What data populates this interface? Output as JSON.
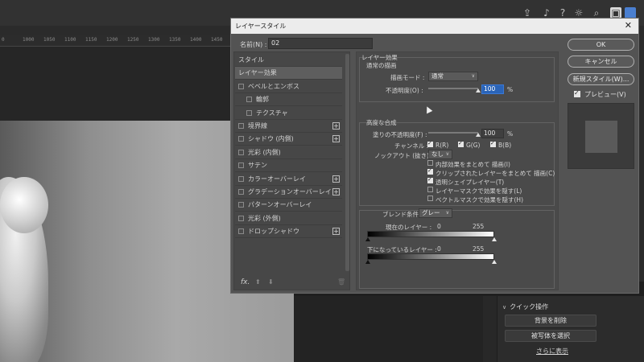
{
  "background": {
    "ruler_ticks": [
      "0",
      "1000",
      "1050",
      "1100",
      "1150",
      "1200",
      "1250",
      "1300",
      "1350",
      "1400",
      "1450"
    ],
    "quick_actions": {
      "header": "クイック操作",
      "remove_bg": "背景を削除",
      "select_subject": "被写体を選択",
      "more": "さらに表示"
    }
  },
  "dialog": {
    "title": "レイヤースタイル",
    "close_icon": "close-icon",
    "name_label": "名前(N) :",
    "name_value": "02",
    "style_list": [
      {
        "label": "スタイル",
        "checkbox": false,
        "plus": false,
        "indent": 0,
        "active": false
      },
      {
        "label": "レイヤー効果",
        "checkbox": false,
        "plus": false,
        "indent": 0,
        "active": true
      },
      {
        "label": "ベベルとエンボス",
        "checkbox": true,
        "plus": false,
        "indent": 0,
        "active": false
      },
      {
        "label": "輪郭",
        "checkbox": true,
        "plus": false,
        "indent": 1,
        "active": false
      },
      {
        "label": "テクスチャ",
        "checkbox": true,
        "plus": false,
        "indent": 1,
        "active": false
      },
      {
        "label": "境界線",
        "checkbox": true,
        "plus": true,
        "indent": 0,
        "active": false
      },
      {
        "label": "シャドウ (内側)",
        "checkbox": true,
        "plus": true,
        "indent": 0,
        "active": false
      },
      {
        "label": "光彩 (内側)",
        "checkbox": true,
        "plus": false,
        "indent": 0,
        "active": false
      },
      {
        "label": "サテン",
        "checkbox": true,
        "plus": false,
        "indent": 0,
        "active": false
      },
      {
        "label": "カラーオーバーレイ",
        "checkbox": true,
        "plus": true,
        "indent": 0,
        "active": false
      },
      {
        "label": "グラデーションオーバーレイ",
        "checkbox": true,
        "plus": true,
        "indent": 0,
        "active": false
      },
      {
        "label": "パターンオーバーレイ",
        "checkbox": true,
        "plus": false,
        "indent": 0,
        "active": false
      },
      {
        "label": "光彩 (外側)",
        "checkbox": true,
        "plus": false,
        "indent": 0,
        "active": false
      },
      {
        "label": "ドロップシャドウ",
        "checkbox": true,
        "plus": true,
        "indent": 0,
        "active": false
      }
    ],
    "footer": {
      "fx": "fx.",
      "up": "⬆",
      "down": "⬇",
      "trash": "🗑"
    },
    "layer_effects": {
      "heading": "レイヤー効果",
      "normal_blend": {
        "heading": "通常の描画",
        "blend_mode_label": "描画モード :",
        "blend_mode_value": "通常",
        "opacity_label": "不透明度(O) :",
        "opacity_value": "100",
        "opacity_unit": "%",
        "opacity_level": 1.0
      },
      "advanced_blend": {
        "heading": "高度な合成",
        "fill_opacity_label": "塗りの不透明度(F) :",
        "fill_opacity_value": "100",
        "fill_opacity_unit": "%",
        "fill_opacity_level": 1.0,
        "channels_label": "チャンネル :",
        "channel_r": "R(R)",
        "channel_g": "G(G)",
        "channel_b": "B(B)",
        "knockout_label": "ノックアウト (抜き) :",
        "knockout_value": "なし",
        "options": [
          {
            "label": "内部効果をまとめて 描画(I)",
            "checked": false
          },
          {
            "label": "クリップされたレイヤーをまとめて 描画(C)",
            "checked": true
          },
          {
            "label": "透明シェイプレイヤー(T)",
            "checked": true
          },
          {
            "label": "レイヤーマスクで効果を隠す(L)",
            "checked": false
          },
          {
            "label": "ベクトルマスクで効果を隠す(H)",
            "checked": false
          }
        ]
      },
      "blend_if": {
        "label": "ブレンド条件 :",
        "value": "グレー",
        "this_layer_label": "現在のレイヤー :",
        "this_layer_min": "0",
        "this_layer_max": "255",
        "underlying_label": "下になっているレイヤー :",
        "underlying_min": "0",
        "underlying_max": "255"
      }
    },
    "buttons": {
      "ok": "OK",
      "cancel": "キャンセル",
      "new_style": "新規スタイル(W)...",
      "preview": "プレビュー(V)"
    }
  }
}
